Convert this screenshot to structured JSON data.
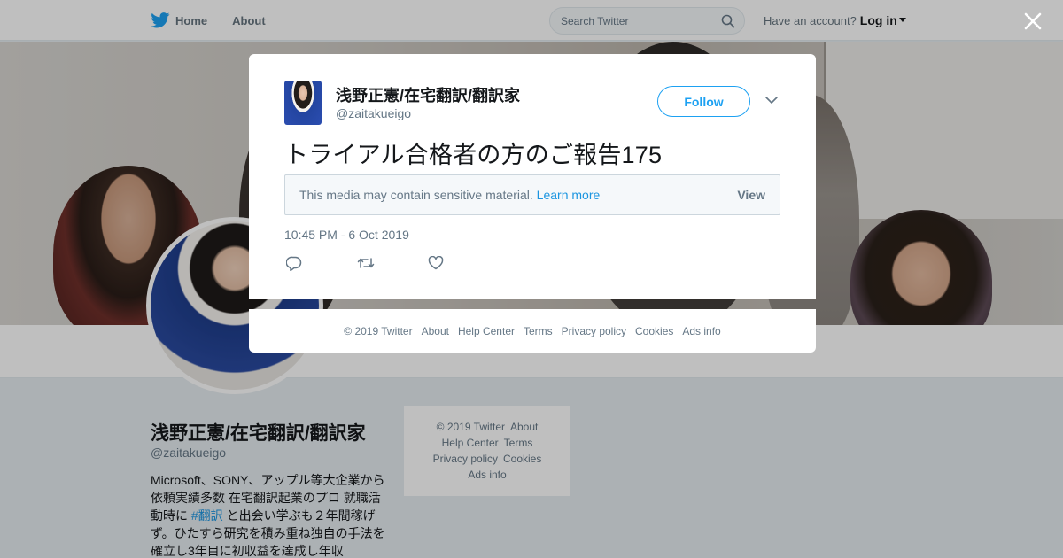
{
  "nav": {
    "home_label": "Home",
    "about_label": "About",
    "search_placeholder": "Search Twitter",
    "have_account": "Have an account?",
    "login_label": "Log in"
  },
  "profile": {
    "name": "浅野正憲/在宅翻訳/翻訳家",
    "handle": "@zaitakueigo",
    "bio_before": "Microsoft、SONY、アップル等大企業から依頼実績多数 在宅翻訳起業のプロ 就職活動時に ",
    "bio_hashtag": "#翻訳",
    "bio_after": " と出会い学ぶも２年間稼げず。ひたすら研究を積み重ね独自の手法を確立し3年目に初収益を達成し年収"
  },
  "side_footer": {
    "copyright": "© 2019 Twitter",
    "about": "About",
    "help": "Help Center",
    "terms": "Terms",
    "privacy": "Privacy policy",
    "cookies": "Cookies",
    "ads": "Ads info"
  },
  "tweet": {
    "author_name": "浅野正憲/在宅翻訳/翻訳家",
    "author_handle": "@zaitakueigo",
    "follow_label": "Follow",
    "text": "トライアル合格者の方のご報告175",
    "sensitive_msg": "This media may contain sensitive material.",
    "learn_more": "Learn more",
    "view_label": "View",
    "timestamp": "10:45 PM - 6 Oct 2019"
  },
  "modal_footer": {
    "copyright": "© 2019 Twitter",
    "about": "About",
    "help": "Help Center",
    "terms": "Terms",
    "privacy": "Privacy policy",
    "cookies": "Cookies",
    "ads": "Ads info"
  },
  "colors": {
    "accent": "#1da1f2",
    "link": "#1b95e0",
    "muted": "#657786"
  }
}
